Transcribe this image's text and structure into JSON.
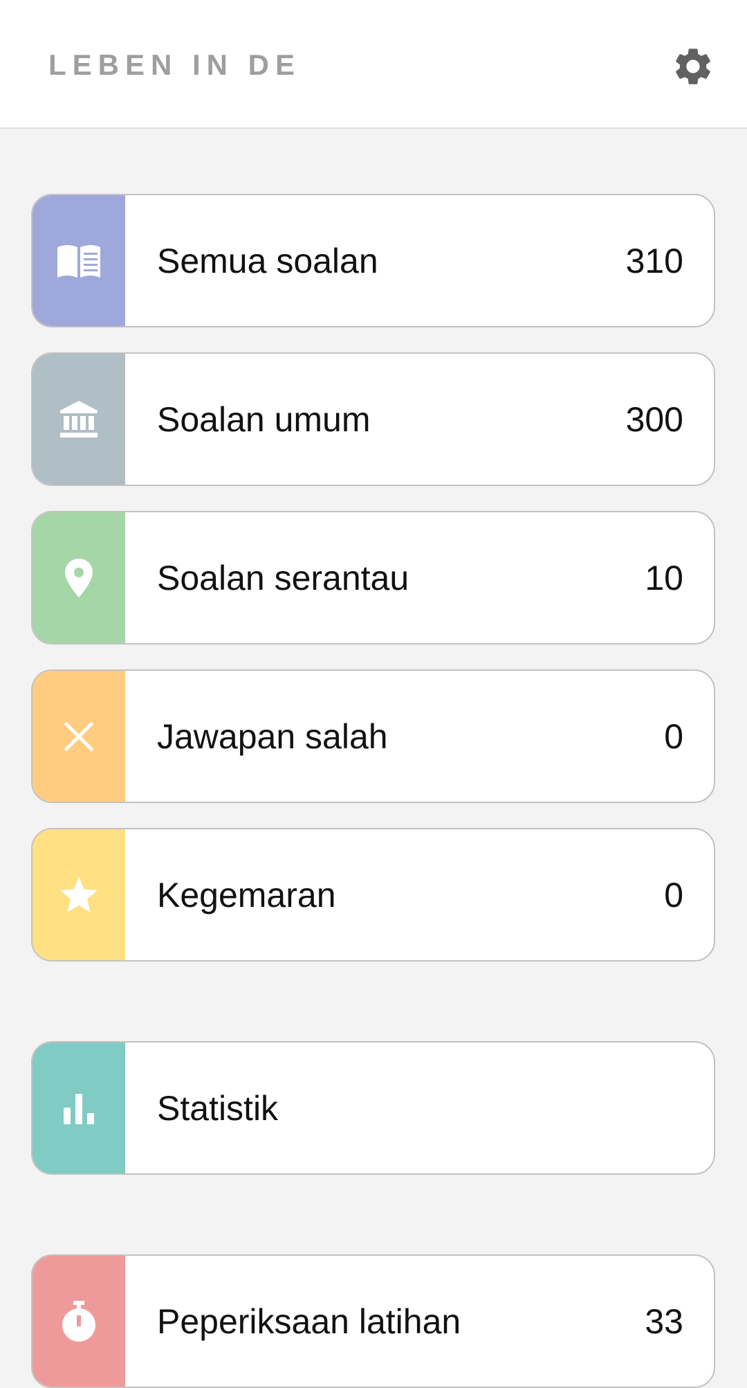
{
  "header": {
    "logo_text": "LEBEN IN DE",
    "settings_icon": "gear-icon"
  },
  "menu": [
    {
      "label": "Semua soalan",
      "count": "310",
      "icon": "book-icon",
      "color": "#9fa8da"
    },
    {
      "label": "Soalan umum",
      "count": "300",
      "icon": "institution-icon",
      "color": "#b0bec5"
    },
    {
      "label": "Soalan serantau",
      "count": "10",
      "icon": "location-pin-icon",
      "color": "#a5d6a7"
    },
    {
      "label": "Jawapan salah",
      "count": "0",
      "icon": "close-icon",
      "color": "#ffcc80"
    },
    {
      "label": "Kegemaran",
      "count": "0",
      "icon": "star-icon",
      "color": "#ffe082"
    }
  ],
  "statistics": {
    "label": "Statistik",
    "icon": "bar-chart-icon",
    "color": "#80cbc4"
  },
  "exam": {
    "label": "Peperiksaan latihan",
    "count": "33",
    "icon": "stopwatch-icon",
    "color": "#ef9a9a"
  }
}
